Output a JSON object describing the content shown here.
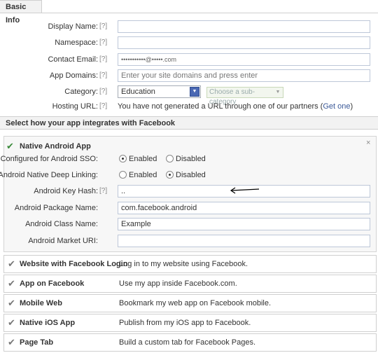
{
  "basic_info": {
    "header": "Basic Info",
    "help": "[?]",
    "display_name": {
      "label": "Display Name:",
      "value": ""
    },
    "namespace": {
      "label": "Namespace:",
      "value": ""
    },
    "contact_email": {
      "label": "Contact Email:",
      "value": "•••••••••••@•••••.com"
    },
    "app_domains": {
      "label": "App Domains:",
      "placeholder": "Enter your site domains and press enter"
    },
    "category": {
      "label": "Category:",
      "value": "Education",
      "sub_placeholder": "Choose a sub-category"
    },
    "hosting_url": {
      "label": "Hosting URL:",
      "text": "You have not generated a URL through one of our partners (",
      "link": "Get one",
      "text_end": ")"
    }
  },
  "integrations": {
    "header": "Select how your app integrates with Facebook",
    "android": {
      "title": "Native Android App",
      "close": "×",
      "ssd": {
        "label": "Configured for Android SSO:",
        "opt1": "Enabled",
        "opt2": "Disabled",
        "selected": "Enabled"
      },
      "deep_linking": {
        "label": "Android Native Deep Linking:",
        "opt1": "Enabled",
        "opt2": "Disabled",
        "selected": "Disabled"
      },
      "key_hash": {
        "label": "Android Key Hash:",
        "value": ".."
      },
      "package_name": {
        "label": "Android Package Name:",
        "value": "com.facebook.android"
      },
      "class_name": {
        "label": "Android Class Name:",
        "value": "Example"
      },
      "market_uri": {
        "label": "Android Market URI:",
        "value": ""
      }
    },
    "items": [
      {
        "name": "Website with Facebook Login",
        "desc": "Log in to my website using Facebook."
      },
      {
        "name": "App on Facebook",
        "desc": "Use my app inside Facebook.com."
      },
      {
        "name": "Mobile Web",
        "desc": "Bookmark my web app on Facebook mobile."
      },
      {
        "name": "Native iOS App",
        "desc": "Publish from my iOS app to Facebook."
      },
      {
        "name": "Page Tab",
        "desc": "Build a custom tab for Facebook Pages."
      }
    ]
  },
  "icons": {
    "check": "check-icon",
    "close": "close-icon",
    "dropdown": "chevron-down-icon",
    "arrow": "arrow-left-annotation"
  }
}
